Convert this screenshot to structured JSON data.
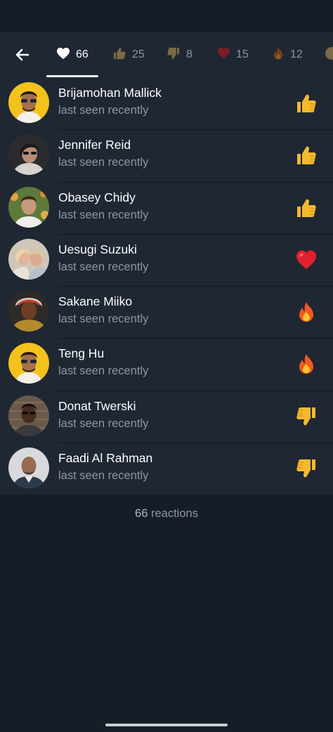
{
  "header": {
    "tabs": [
      {
        "icon": "heart-icon",
        "count": "66",
        "active": true
      },
      {
        "icon": "thumbs-up-icon",
        "count": "25",
        "active": false
      },
      {
        "icon": "thumbs-down-icon",
        "count": "8",
        "active": false
      },
      {
        "icon": "red-heart-icon",
        "count": "15",
        "active": false
      },
      {
        "icon": "fire-icon",
        "count": "12",
        "active": false
      }
    ]
  },
  "reactions": [
    {
      "name": "Brijamohan Mallick",
      "status": "last seen recently",
      "reaction": "thumbs-up-icon"
    },
    {
      "name": "Jennifer Reid",
      "status": "last seen recently",
      "reaction": "thumbs-up-icon"
    },
    {
      "name": "Obasey Chidy",
      "status": "last seen recently",
      "reaction": "thumbs-up-icon"
    },
    {
      "name": "Uesugi Suzuki",
      "status": "last seen recently",
      "reaction": "red-heart-icon"
    },
    {
      "name": "Sakane Miiko",
      "status": "last seen recently",
      "reaction": "fire-icon"
    },
    {
      "name": "Teng Hu",
      "status": "last seen recently",
      "reaction": "fire-icon"
    },
    {
      "name": "Donat Twerski",
      "status": "last seen recently",
      "reaction": "thumbs-down-icon"
    },
    {
      "name": "Faadi Al Rahman",
      "status": "last seen recently",
      "reaction": "thumbs-down-icon"
    }
  ],
  "footer": {
    "count": "66",
    "label": "reactions"
  },
  "colors": {
    "background": "#171d27",
    "row": "#1f2733",
    "muted_text": "#8b96a6",
    "emoji_yellow": "#f5b92e",
    "heart_red": "#e0202c"
  }
}
